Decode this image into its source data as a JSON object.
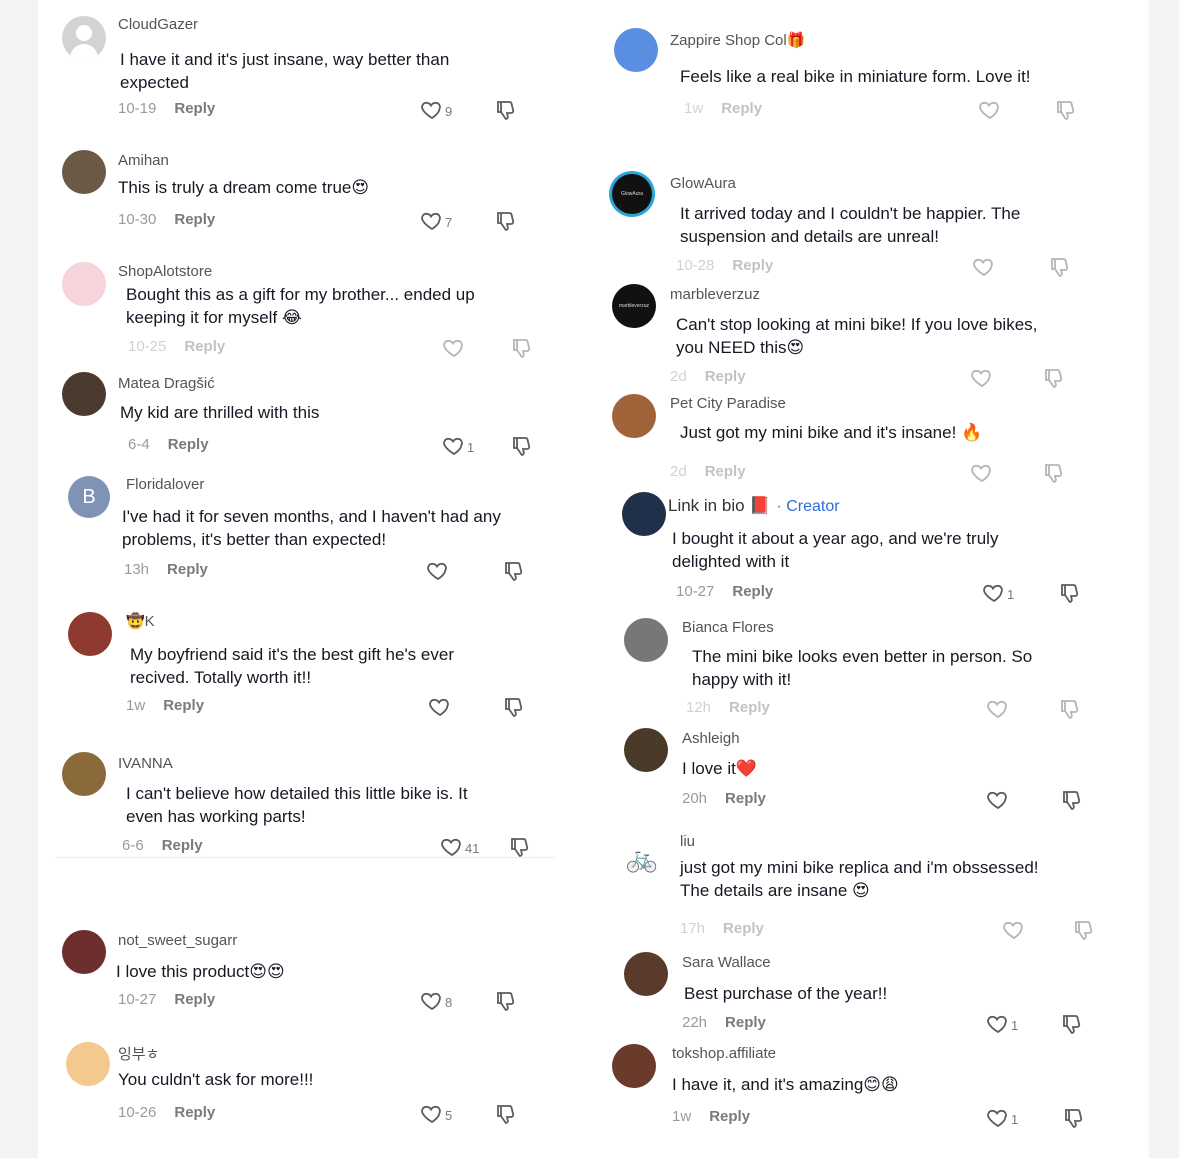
{
  "left": [
    {
      "user": "CloudGazer",
      "lines": [
        "I have it and it's just insane, way better than",
        "expected"
      ],
      "date": "10-19",
      "reply": "Reply",
      "likes": "9"
    },
    {
      "user": "Amihan",
      "lines": [
        "This is truly a dream come true😍"
      ],
      "date": "10-30",
      "reply": "Reply",
      "likes": "7"
    },
    {
      "user": "ShopAlotstore",
      "lines": [
        "Bought this as a gift for my brother... ended up",
        "keeping it for myself 😂"
      ],
      "date": "10-25",
      "reply": "Reply",
      "likes": ""
    },
    {
      "user": "Matea Dragšić",
      "lines": [
        "My kid are thrilled with this"
      ],
      "date": "6-4",
      "reply": "Reply",
      "likes": "1"
    },
    {
      "user": "Floridalover",
      "lines": [
        "I've had it for seven months, and I haven't had any",
        "problems, it's better than expected!"
      ],
      "date": "13h",
      "reply": "Reply",
      "likes": "",
      "avatar_letter": "B"
    },
    {
      "user": "🤠K",
      "lines": [
        "My boyfriend said it's the best gift he's ever",
        "recived. Totally worth it!!"
      ],
      "date": "1w",
      "reply": "Reply",
      "likes": ""
    },
    {
      "user": "IVANNA",
      "lines": [
        "I can't believe how detailed this little bike is. It",
        "even has working parts!"
      ],
      "date": "6-6",
      "reply": "Reply",
      "likes": "41"
    },
    {
      "user": "not_sweet_sugarr",
      "lines": [
        "I love this product😍😍"
      ],
      "date": "10-27",
      "reply": "Reply",
      "likes": "8"
    },
    {
      "user": "잉부ㅎ",
      "lines": [
        "You culdn't ask for more!!!"
      ],
      "date": "10-26",
      "reply": "Reply",
      "likes": "5"
    }
  ],
  "right": [
    {
      "user": "Zappire Shop Col🎁",
      "lines": [
        "Feels like a real bike in miniature form. Love it!"
      ],
      "date": "1w",
      "reply": "Reply",
      "likes": ""
    },
    {
      "user": "GlowAura",
      "lines": [
        "It arrived today and I couldn't be happier. The",
        "suspension and details are unreal!"
      ],
      "date": "10-28",
      "reply": "Reply",
      "likes": ""
    },
    {
      "user": "marbleverzuz",
      "lines": [
        "Can't stop looking at mini bike! If you love bikes,",
        "you NEED this😍"
      ],
      "date": "2d",
      "reply": "Reply",
      "likes": ""
    },
    {
      "user": "Pet City Paradise",
      "lines": [
        "Just got my mini bike and it's insane! 🔥"
      ],
      "date": "2d",
      "reply": "Reply",
      "likes": ""
    },
    {
      "user": "Link in bio 📕",
      "creator": "· Creator",
      "lines": [
        "I bought it about a year ago, and we're truly",
        "delighted with it"
      ],
      "date": "10-27",
      "reply": "Reply",
      "likes": "1"
    },
    {
      "user": "Bianca Flores",
      "lines": [
        "The mini bike looks even better in person. So",
        "happy with it!"
      ],
      "date": "12h",
      "reply": "Reply",
      "likes": ""
    },
    {
      "user": "Ashleigh",
      "lines": [
        "I love it❤️"
      ],
      "date": "20h",
      "reply": "Reply",
      "likes": ""
    },
    {
      "user": "liu",
      "lines": [
        "just got my mini bike replica and i'm obssessed!",
        "The details are insane 😍"
      ],
      "date": "17h",
      "reply": "Reply",
      "likes": ""
    },
    {
      "user": "Sara Wallace",
      "lines": [
        "Best purchase of the year!!"
      ],
      "date": "22h",
      "reply": "Reply",
      "likes": "1"
    },
    {
      "user": "tokshop.affiliate",
      "lines": [
        "I have it, and it's amazing😊😩"
      ],
      "date": "1w",
      "reply": "Reply",
      "likes": "1"
    }
  ],
  "avatar_text": {
    "glowaura": "GlowAura",
    "marble": "marbleverzuz"
  },
  "colors": {
    "text": "#161823",
    "username": "#545454",
    "meta": "#9a9a9a",
    "creator": "#2b6fd6"
  }
}
